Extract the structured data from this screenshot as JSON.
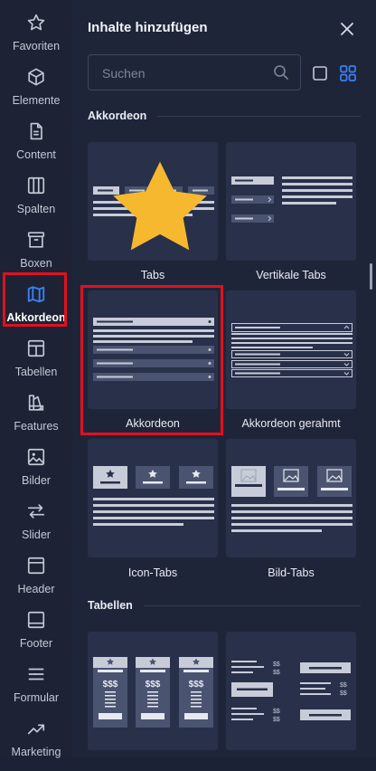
{
  "sidebar": {
    "items": [
      {
        "label": "Favoriten",
        "icon": "star-icon"
      },
      {
        "label": "Elemente",
        "icon": "cube-icon"
      },
      {
        "label": "Content",
        "icon": "document-icon"
      },
      {
        "label": "Spalten",
        "icon": "columns-icon"
      },
      {
        "label": "Boxen",
        "icon": "box-icon"
      },
      {
        "label": "Akkordeon",
        "icon": "map-icon",
        "active": true
      },
      {
        "label": "Tabellen",
        "icon": "table-icon"
      },
      {
        "label": "Features",
        "icon": "features-icon"
      },
      {
        "label": "Bilder",
        "icon": "image-icon"
      },
      {
        "label": "Slider",
        "icon": "slider-arrows-icon"
      },
      {
        "label": "Header",
        "icon": "header-icon"
      },
      {
        "label": "Footer",
        "icon": "footer-icon"
      },
      {
        "label": "Formular",
        "icon": "form-icon"
      },
      {
        "label": "Marketing",
        "icon": "trend-icon"
      }
    ]
  },
  "panel": {
    "title": "Inhalte hinzufügen",
    "search_placeholder": "Suchen",
    "sections": [
      {
        "title": "Akkordeon",
        "cards": [
          {
            "label": "Tabs",
            "favorite": true
          },
          {
            "label": "Vertikale Tabs"
          },
          {
            "label": "Akkordeon",
            "highlighted": true
          },
          {
            "label": "Akkordeon gerahmt"
          },
          {
            "label": "Icon-Tabs"
          },
          {
            "label": "Bild-Tabs"
          }
        ]
      },
      {
        "title": "Tabellen",
        "cards": [
          {
            "label": "",
            "thumb_text": "$$$"
          },
          {
            "label": "",
            "thumb_text": "$$"
          }
        ]
      }
    ]
  },
  "colors": {
    "background": "#1f2539",
    "card": "#28304a",
    "accent": "#3b82f6",
    "highlight": "#e01020",
    "star": "#f5b82e"
  }
}
